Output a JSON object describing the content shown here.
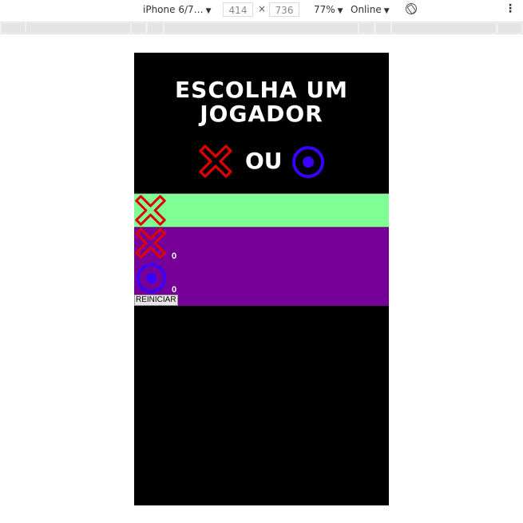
{
  "devtools": {
    "device": "iPhone 6/7…",
    "width": "414",
    "height": "736",
    "times": "×",
    "zoom": "77%",
    "network": "Online",
    "arrow": "▼",
    "more": "⋮"
  },
  "game": {
    "title_line1": "ESCOLHA UM",
    "title_line2": "JOGADOR",
    "or_label": "OU",
    "score_x": "0",
    "score_o": "0",
    "reset_label": "REINICIAR"
  },
  "colors": {
    "background": "#000000",
    "x_color": "#e00000",
    "o_color": "#3a00ff",
    "turn_bar": "#80ff96",
    "score_panel": "#760097"
  },
  "icons": {
    "choose_x": "x-mark-icon",
    "choose_o": "circle-dot-icon",
    "turn": "x-mark-icon",
    "rotate": "rotate-icon"
  }
}
